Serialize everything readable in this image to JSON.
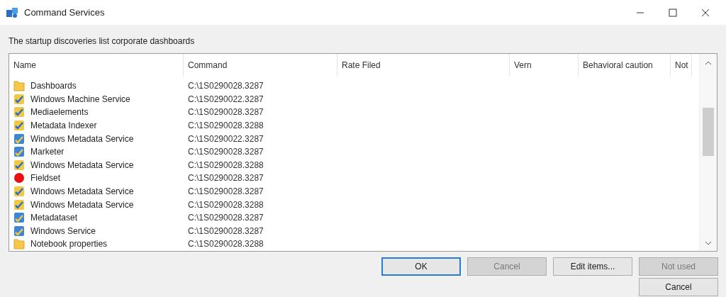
{
  "window": {
    "title": "Command Services"
  },
  "description": "The startup discoveries list corporate dashboards",
  "table": {
    "columns": [
      "Name",
      "Command",
      "Rate Filed",
      "Vern",
      "Behavioral caution",
      "Not"
    ],
    "rows": [
      {
        "kind": "folder",
        "name": "Dashboards",
        "command": "C:\\1S0290028.3287"
      },
      {
        "kind": "shield-yellow",
        "name": "Windows Machine Service",
        "command": "C:\\1S0290022.3287"
      },
      {
        "kind": "shield-yellow",
        "name": "Mediaelements",
        "command": "C:\\1S0290028.3287"
      },
      {
        "kind": "shield-yellow",
        "name": "Metadata Indexer",
        "command": "C:\\1S0290028.3288"
      },
      {
        "kind": "shield-blue",
        "name": "Windows Metadata Service",
        "command": "C:\\1S0290022.3287"
      },
      {
        "kind": "shield-blue",
        "name": "Marketer",
        "command": "C:\\1S0290028.3287"
      },
      {
        "kind": "shield-yellow",
        "name": "Windows Metadata Service",
        "command": "C:\\1S0290028.3288"
      },
      {
        "kind": "stop",
        "name": "Fieldset",
        "command": "C:\\1S0290028.3287"
      },
      {
        "kind": "shield-yellow",
        "name": "Windows Metadata Service",
        "command": "C:\\1S0290028.3287"
      },
      {
        "kind": "shield-yellow",
        "name": "Windows Metadata Service",
        "command": "C:\\1S0290028.3288"
      },
      {
        "kind": "shield-blue",
        "name": "Metadataset",
        "command": "C:\\1S0290028.3287"
      },
      {
        "kind": "shield-blue",
        "name": "Windows Service",
        "command": "C:\\1S0290028.3287"
      },
      {
        "kind": "folder",
        "name": "Notebook properties",
        "command": "C:\\1S0290028.3288"
      }
    ]
  },
  "buttons": [
    {
      "label": "OK",
      "default": true,
      "disabled": false
    },
    {
      "label": "Cancel",
      "default": false,
      "disabled": true
    },
    {
      "label": "Edit items...",
      "default": false,
      "disabled": false
    },
    {
      "label": "Not used",
      "default": false,
      "disabled": true
    },
    {
      "label": "Cancel",
      "default": false,
      "disabled": false
    }
  ]
}
